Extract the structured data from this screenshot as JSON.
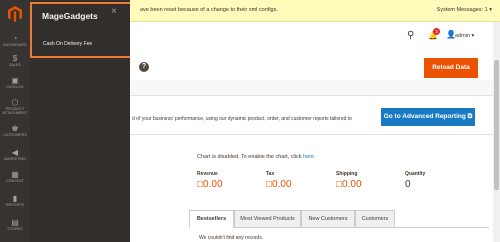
{
  "sidebar": {
    "items": [
      {
        "label": "DASHBOARD",
        "icon": "dashboard-icon",
        "glyph": "◔"
      },
      {
        "label": "SALES",
        "icon": "sales-icon",
        "glyph": "$"
      },
      {
        "label": "CATALOG",
        "icon": "catalog-icon",
        "glyph": "▣"
      },
      {
        "label": "PRODUCT ATTACHMENT",
        "icon": "product-attachment-icon",
        "glyph": "⬡"
      },
      {
        "label": "CUSTOMERS",
        "icon": "customers-icon",
        "glyph": "♚"
      },
      {
        "label": "MARKETING",
        "icon": "marketing-icon",
        "glyph": "◀"
      },
      {
        "label": "CONTENT",
        "icon": "content-icon",
        "glyph": "▦"
      },
      {
        "label": "REPORTS",
        "icon": "reports-icon",
        "glyph": "▮"
      },
      {
        "label": "STORES",
        "icon": "stores-icon",
        "glyph": "▤"
      }
    ]
  },
  "flyout": {
    "title": "MageGadgets",
    "close": "×",
    "link": "Cash On Delivery Fee"
  },
  "system_bar": {
    "text": "ave been reset because of a change to their xml configs.",
    "messages": "System Messages: 1 ▾"
  },
  "header": {
    "search": "⚲",
    "bell": "🔔",
    "notification_count": "3",
    "user_glyph": "👤",
    "user_name": "admin ▾"
  },
  "title_bar": {
    "help": "?",
    "reload_label": "Reload Data"
  },
  "notice": {
    "text": "d of your business' performance, using our dynamic product, order, and customer reports tailored to",
    "button_label": "Go to Advanced Reporting ⧉"
  },
  "dashboard": {
    "chart_disabled_prefix": "Chart is disabled. To enable the chart, click ",
    "chart_disabled_link": "here.",
    "stats": [
      {
        "label": "Revenue",
        "value": "□0.00"
      },
      {
        "label": "Tax",
        "value": "□0.00"
      },
      {
        "label": "Shipping",
        "value": "□0.00"
      },
      {
        "label": "Quantity",
        "value": "0"
      }
    ],
    "tabs": [
      "Bestsellers",
      "Most Viewed Products",
      "New Customers",
      "Customers"
    ],
    "empty_message": "We couldn't find any records."
  },
  "colors": {
    "accent": "#eb5202",
    "primary_button": "#1979c3",
    "highlight": "#eb7a35",
    "sidebar": "#373330"
  }
}
